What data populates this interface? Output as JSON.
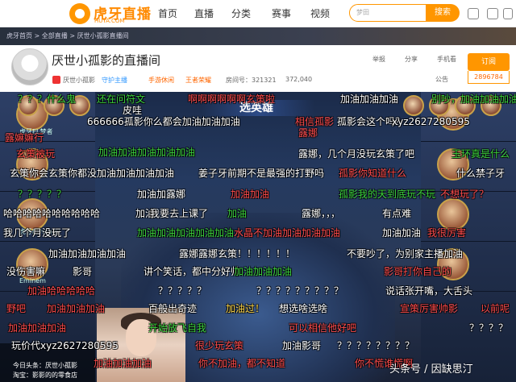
{
  "nav": {
    "logo_text": "虎牙直播",
    "logo_sub": "HUYA.COM",
    "items": [
      "首页",
      "直播",
      "分类",
      "赛事",
      "视频"
    ],
    "search_placeholder": "梦田",
    "search_button": "搜索"
  },
  "breadcrumb": "虎牙首页 > 全部直播 > 厌世小孤影直播间",
  "room": {
    "title": "厌世小孤影的直播间",
    "host": "厌世小孤影",
    "guard_tag": "守护主播",
    "category_1": "手游休闲",
    "category_2": "王者荣耀",
    "room_id_label": "房间号：321321",
    "viewers": "372,040",
    "report": "举报",
    "share": "分享",
    "mobile": "手机看",
    "subscribe": "订阅",
    "subscribers": "2896784",
    "notice": "公告"
  },
  "video": {
    "select_title": "选英雄",
    "left_players": [
      "虎牙EL梦者",
      "",
      "虎牙ELhappy",
      "Eminem",
      ""
    ],
    "stream_lines": [
      "今日头条：厌世小孤影",
      "淘宝：影影的的零食店"
    ],
    "watermark": "头条号 / 因缺思汀"
  },
  "danmaku": [
    {
      "text": "？？？什么鬼",
      "color": "#3cd23c"
    },
    {
      "text": "还在问符文",
      "color": "#3cd23c"
    },
    {
      "text": "啊啊啊啊啊啊玄策啦",
      "color": "#ff4b4b"
    },
    {
      "text": "加油加油加油",
      "color": "#ffffff"
    },
    {
      "text": "别吵，加油加油加油",
      "color": "#3cd23c"
    },
    {
      "text": "皮哇",
      "color": "#ffffff"
    },
    {
      "text": "666666孤影你么都会加油加油加油",
      "color": "#ffffff"
    },
    {
      "text": "相信孤影",
      "color": "#ff4b4b"
    },
    {
      "text": "孤影会这个吗？",
      "color": "#ffffff"
    },
    {
      "text": "xyz2627280595",
      "color": "#ffffff"
    },
    {
      "text": "露娜",
      "color": "#ff4b4b"
    },
    {
      "text": "露嫲嫲行",
      "color": "#ff4b4b"
    },
    {
      "text": "玄策被玩",
      "color": "#ff4b4b"
    },
    {
      "text": "加油加油加油加油加油",
      "color": "#3cd23c"
    },
    {
      "text": "露娜，几个月没玩玄策了吧",
      "color": "#ffffff"
    },
    {
      "text": "玉环真是什么",
      "color": "#3cd23c"
    },
    {
      "text": "玄策你会玄策你都没加油加油加油加油",
      "color": "#ffffff"
    },
    {
      "text": "姜子牙前期不是最强的打野吗",
      "color": "#ffffff"
    },
    {
      "text": "孤影你知道什么",
      "color": "#ff4b4b"
    },
    {
      "text": "什么禁子牙",
      "color": "#ffffff"
    },
    {
      "text": "？？？？？",
      "color": "#3cd23c"
    },
    {
      "text": "加油加露娜",
      "color": "#ffffff"
    },
    {
      "text": "加油加油",
      "color": "#ff4b4b"
    },
    {
      "text": "孤影我的天到底玩不玩",
      "color": "#3cd23c"
    },
    {
      "text": "不想玩了？",
      "color": "#ff4b4b"
    },
    {
      "text": "哈哈哈哈哈哈哈哈哈哈",
      "color": "#ffffff"
    },
    {
      "text": "加油",
      "color": "#ffffff"
    },
    {
      "text": "我要去上课了",
      "color": "#ffffff"
    },
    {
      "text": "加油",
      "color": "#3cd23c"
    },
    {
      "text": "露娜，，，",
      "color": "#ffffff"
    },
    {
      "text": "有点难",
      "color": "#ffffff"
    },
    {
      "text": "我几个月没玩了",
      "color": "#ffffff"
    },
    {
      "text": "加油加油加油加油加油",
      "color": "#3cd23c"
    },
    {
      "text": "水晶不加油加油加油加油",
      "color": "#ff4b4b"
    },
    {
      "text": "加油加油",
      "color": "#ffffff"
    },
    {
      "text": "我很厉害",
      "color": "#ff4b4b"
    },
    {
      "text": "加油加油加油加油",
      "color": "#ffffff"
    },
    {
      "text": "露娜露娜玄策！！！！！！",
      "color": "#ffffff"
    },
    {
      "text": "不要吵了，为别家主播加油",
      "color": "#ffffff"
    },
    {
      "text": "没伤害嘛",
      "color": "#ffffff"
    },
    {
      "text": "影哥",
      "color": "#ffffff"
    },
    {
      "text": "讲个笑话，都中分好帅",
      "color": "#ffffff"
    },
    {
      "text": "加油加油加油",
      "color": "#3cd23c"
    },
    {
      "text": "影哥打你自己的",
      "color": "#ff4b4b"
    },
    {
      "text": "加油哈哈哈哈哈",
      "color": "#ff4b4b"
    },
    {
      "text": "？？？？？",
      "color": "#ffffff"
    },
    {
      "text": "？？？？？？？？？",
      "color": "#ffffff"
    },
    {
      "text": "说话张开嘴，大舌头",
      "color": "#ffffff"
    },
    {
      "text": "野吧",
      "color": "#ff4b4b"
    },
    {
      "text": "加油加油加油",
      "color": "#ff4b4b"
    },
    {
      "text": "百般出奇迹",
      "color": "#ffffff"
    },
    {
      "text": "加油过！",
      "color": "#ffd84b"
    },
    {
      "text": "想选啥选啥",
      "color": "#ffffff"
    },
    {
      "text": "宣策厉害帅影",
      "color": "#ff4b4b"
    },
    {
      "text": "以前呢",
      "color": "#ff4b4b"
    },
    {
      "text": "加油加油加油",
      "color": "#ff4b4b"
    },
    {
      "text": "开始放飞自我",
      "color": "#3cd23c"
    },
    {
      "text": "可以相信他好吧",
      "color": "#ff4b4b"
    },
    {
      "text": "？？？？",
      "color": "#ffffff"
    },
    {
      "text": "玩价代xyz2627280595",
      "color": "#ffffff"
    },
    {
      "text": "很少玩玄策",
      "color": "#ff4b4b"
    },
    {
      "text": "加油影哥",
      "color": "#ffffff"
    },
    {
      "text": "？？？？？？？？",
      "color": "#ffffff"
    },
    {
      "text": "加油加油加油",
      "color": "#ff4b4b"
    },
    {
      "text": "你不加油，都不知道",
      "color": "#ff4b4b"
    },
    {
      "text": "你不慌谁慌啊",
      "color": "#ff4b4b"
    }
  ]
}
